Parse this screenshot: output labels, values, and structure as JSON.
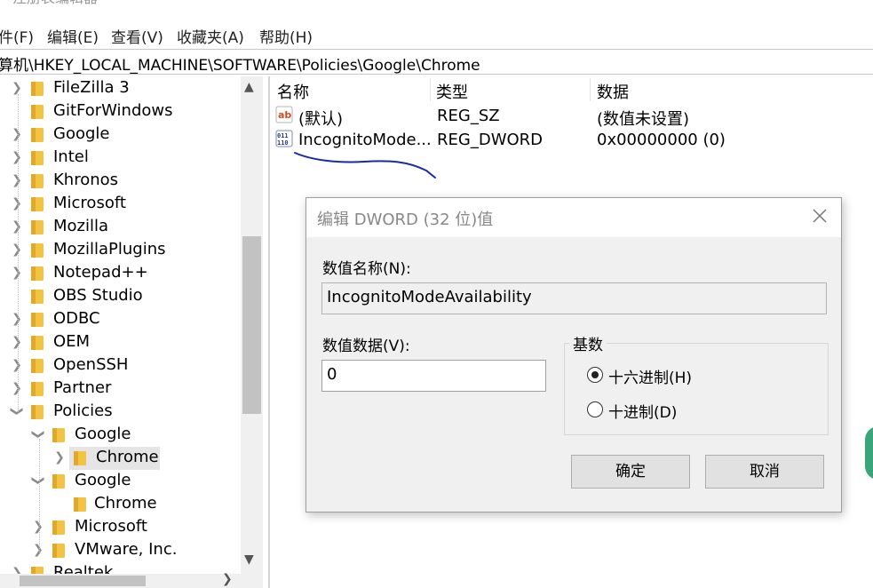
{
  "window": {
    "title": "注册表编辑器"
  },
  "menu": [
    "件(F)",
    "编辑(E)",
    "查看(V)",
    "收藏夹(A)",
    "帮助(H)"
  ],
  "address": "算机\\HKEY_LOCAL_MACHINE\\SOFTWARE\\Policies\\Google\\Chrome",
  "tree": [
    {
      "label": "FileZilla 3"
    },
    {
      "label": "GitForWindows"
    },
    {
      "label": "Google"
    },
    {
      "label": "Intel"
    },
    {
      "label": "Khronos"
    },
    {
      "label": "Microsoft"
    },
    {
      "label": "Mozilla"
    },
    {
      "label": "MozillaPlugins"
    },
    {
      "label": "Notepad++"
    },
    {
      "label": "OBS Studio"
    },
    {
      "label": "ODBC"
    },
    {
      "label": "OEM"
    },
    {
      "label": "OpenSSH"
    },
    {
      "label": "Partner"
    },
    {
      "label": "Policies"
    },
    {
      "label": "Google"
    },
    {
      "label": "Chrome"
    },
    {
      "label": "Google"
    },
    {
      "label": "Chrome"
    },
    {
      "label": "Microsoft"
    },
    {
      "label": "VMware, Inc."
    },
    {
      "label": "Realtek"
    }
  ],
  "list": {
    "headers": [
      "名称",
      "类型",
      "数据"
    ],
    "rows": [
      {
        "name": "(默认)",
        "type": "REG_SZ",
        "data": "(数值未设置)",
        "icon": "string-value-icon"
      },
      {
        "name": "IncognitoMode...",
        "type": "REG_DWORD",
        "data": "0x00000000 (0)",
        "icon": "binary-value-icon"
      }
    ]
  },
  "dialog": {
    "title": "编辑 DWORD (32 位)值",
    "name_label": "数值名称(N):",
    "name_value": "IncognitoModeAvailability",
    "data_label": "数值数据(V):",
    "data_value": "0",
    "base_label": "基数",
    "hex_label": "十六进制(H)",
    "dec_label": "十进制(D)",
    "base_selected": "hex",
    "ok_label": "确定",
    "cancel_label": "取消"
  },
  "colors": {
    "folder": "#f3c443",
    "selection": "#e5e5e5",
    "ink": "#1a2aa8"
  }
}
